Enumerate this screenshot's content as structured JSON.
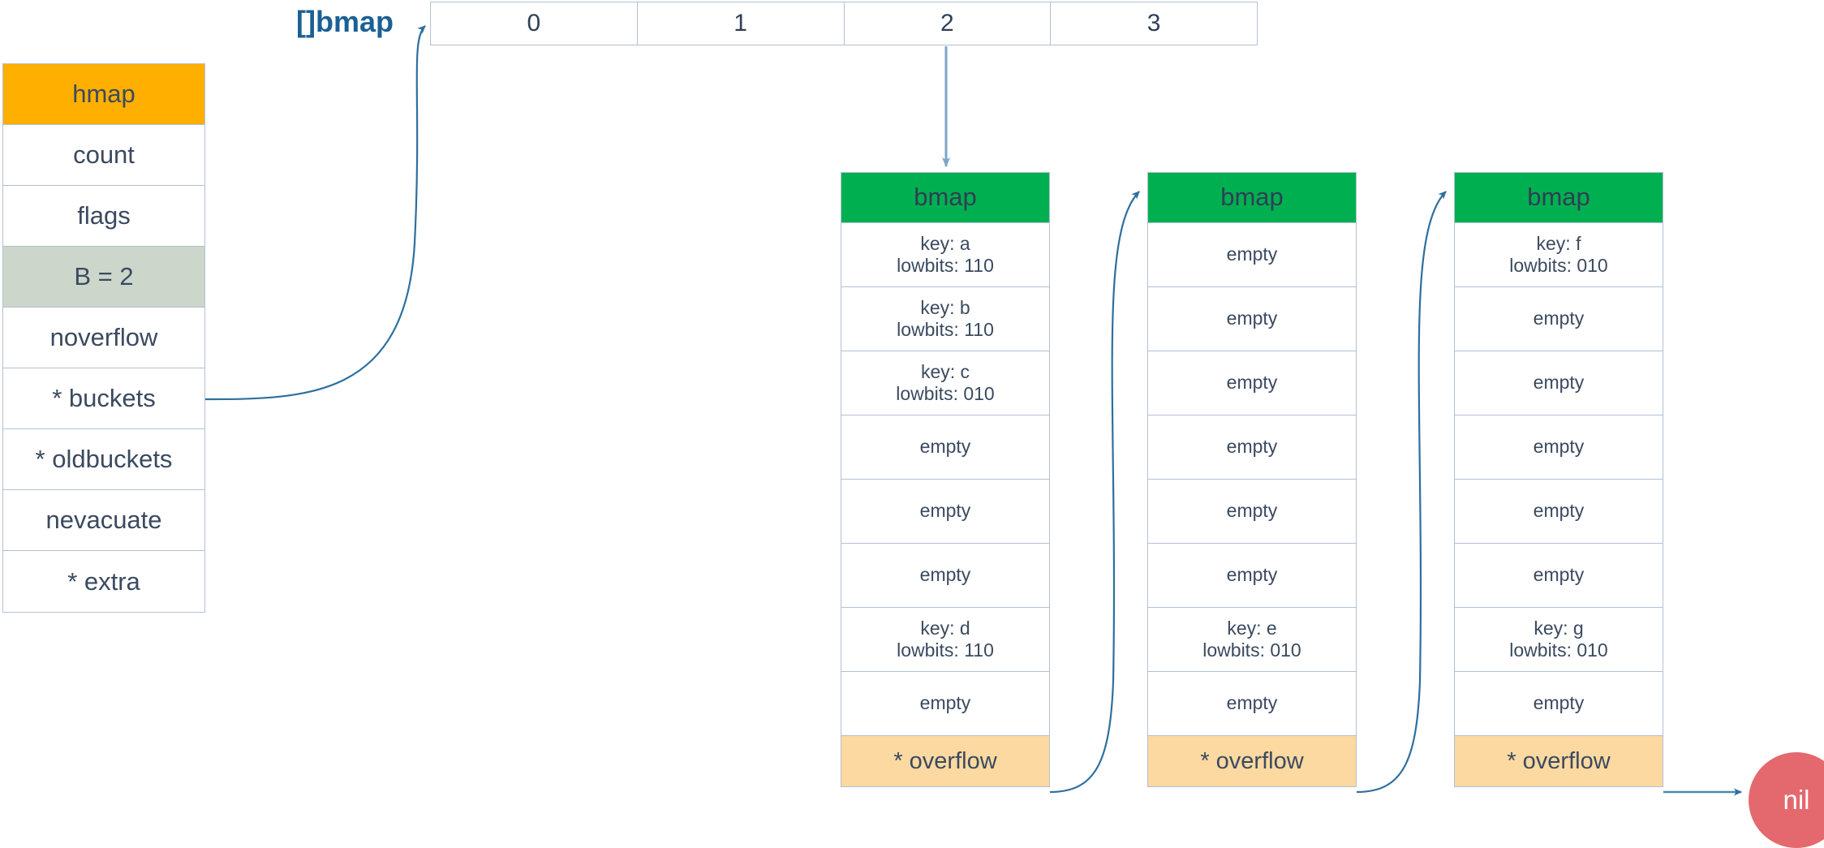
{
  "colors": {
    "hmap_header": "#FFAF00",
    "hmap_highlight": "#CCD6CA",
    "bmap_header": "#00B050",
    "overflow_row": "#FCD9A0",
    "nil_circle": "#E4696E",
    "border": "#b3c0d4",
    "text": "#3b4a5f",
    "label_blue": "#1b6094",
    "arrow": "#2e74a8"
  },
  "hmap": {
    "title": "hmap",
    "fields": [
      {
        "label": "count",
        "highlight": false
      },
      {
        "label": "flags",
        "highlight": false
      },
      {
        "label": "B = 2",
        "highlight": true
      },
      {
        "label": "noverflow",
        "highlight": false
      },
      {
        "label": "* buckets",
        "highlight": false
      },
      {
        "label": "* oldbuckets",
        "highlight": false
      },
      {
        "label": "nevacuate",
        "highlight": false
      },
      {
        "label": "* extra",
        "highlight": false
      }
    ]
  },
  "bucket_array": {
    "label": "[]bmap",
    "cells": [
      "0",
      "1",
      "2",
      "3"
    ]
  },
  "buckets": [
    {
      "title": "bmap",
      "slots": [
        {
          "line1": "key: a",
          "line2": "lowbits: 110"
        },
        {
          "line1": "key: b",
          "line2": "lowbits: 110"
        },
        {
          "line1": "key: c",
          "line2": "lowbits: 010"
        },
        {
          "line1": "empty",
          "line2": ""
        },
        {
          "line1": "empty",
          "line2": ""
        },
        {
          "line1": "empty",
          "line2": ""
        },
        {
          "line1": "key: d",
          "line2": "lowbits: 110"
        },
        {
          "line1": "empty",
          "line2": ""
        }
      ],
      "overflow": "* overflow"
    },
    {
      "title": "bmap",
      "slots": [
        {
          "line1": "empty",
          "line2": ""
        },
        {
          "line1": "empty",
          "line2": ""
        },
        {
          "line1": "empty",
          "line2": ""
        },
        {
          "line1": "empty",
          "line2": ""
        },
        {
          "line1": "empty",
          "line2": ""
        },
        {
          "line1": "empty",
          "line2": ""
        },
        {
          "line1": "key: e",
          "line2": "lowbits: 010"
        },
        {
          "line1": "empty",
          "line2": ""
        }
      ],
      "overflow": "* overflow"
    },
    {
      "title": "bmap",
      "slots": [
        {
          "line1": "key: f",
          "line2": "lowbits: 010"
        },
        {
          "line1": "empty",
          "line2": ""
        },
        {
          "line1": "empty",
          "line2": ""
        },
        {
          "line1": "empty",
          "line2": ""
        },
        {
          "line1": "empty",
          "line2": ""
        },
        {
          "line1": "empty",
          "line2": ""
        },
        {
          "line1": "key: g",
          "line2": "lowbits: 010"
        },
        {
          "line1": "empty",
          "line2": ""
        }
      ],
      "overflow": "* overflow"
    }
  ],
  "nil_node": {
    "label": "nil"
  }
}
